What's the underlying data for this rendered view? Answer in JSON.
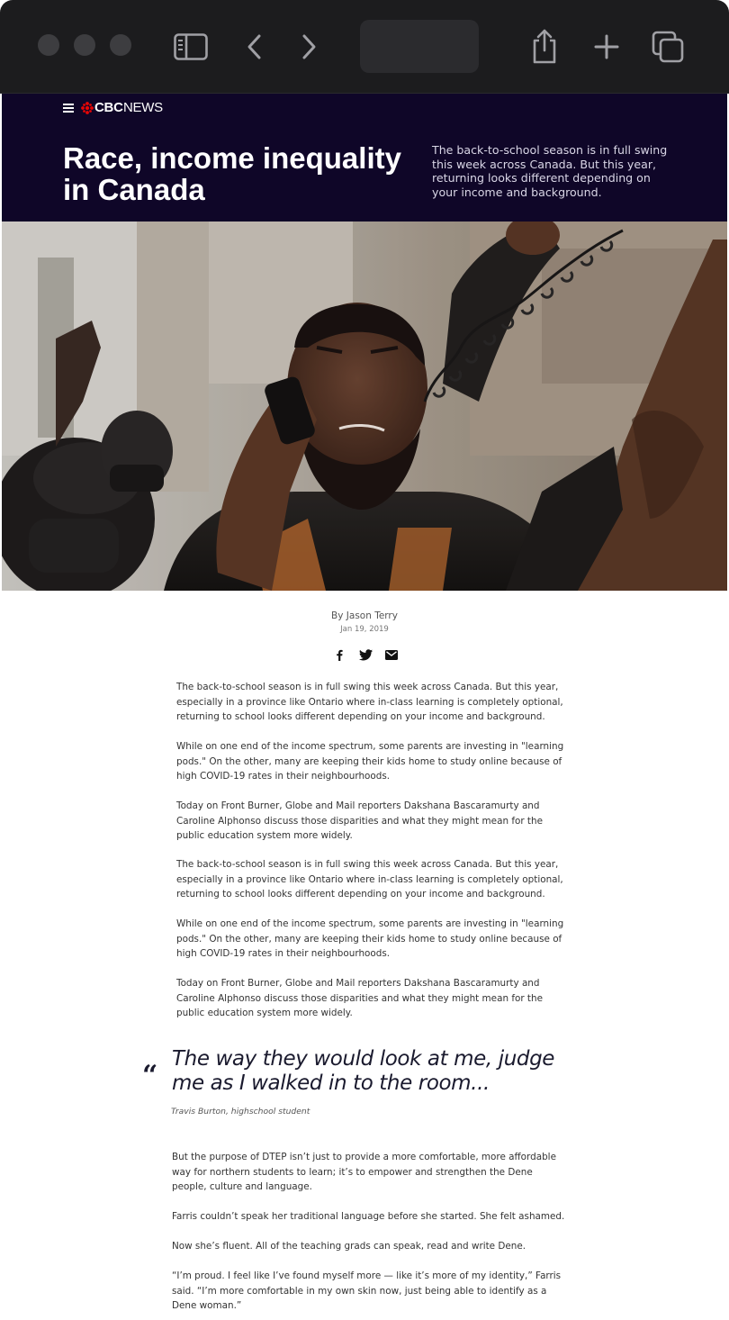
{
  "browser": {
    "icons": [
      "sidebar-icon",
      "back-icon",
      "forward-icon",
      "share-icon",
      "new-tab-icon",
      "tabs-icon"
    ]
  },
  "site": {
    "logo_cbc": "CBC",
    "logo_news": "NEWS"
  },
  "hero": {
    "title": "Race, income inequality in Canada",
    "dek": "The back-to-school season is in full swing this week across Canada. But this year, returning  looks different depending on your income and background."
  },
  "article": {
    "byline": "By Jason Terry",
    "date": "Jan 19, 2019",
    "share_icons": [
      "facebook-icon",
      "twitter-icon",
      "email-icon"
    ],
    "paragraphs": [
      "The back-to-school season is in full swing this week across Canada. But this year, especially in a province like Ontario where in-class learning is completely optional, returning to school looks different depending on your income and background.",
      "While on one end of the income spectrum, some parents are investing in \"learning pods.\" On the other, many are keeping their kids home to study online because of high COVID-19 rates in their neighbourhoods.",
      "Today on Front Burner, Globe and Mail reporters Dakshana Bascaramurty and Caroline Alphonso discuss those disparities and what they might mean for the public education system more widely.",
      "The back-to-school season is in full swing this week across Canada. But this year, especially in a province like Ontario where in-class learning is completely optional, returning to school looks different depending on your income and background.",
      "While on one end of the income spectrum, some parents are investing in \"learning pods.\" On the other, many are keeping their kids home to study online because of high COVID-19 rates in their neighbourhoods.",
      "Today on Front Burner, Globe and Mail reporters Dakshana Bascaramurty and Caroline Alphonso discuss those disparities and what they might mean for the public education system more widely."
    ],
    "quote": {
      "mark": "“",
      "text": "The way they would look at me, judge me as I walked in to the room...",
      "attribution": "Travis Burton, highschool student"
    },
    "after_paragraphs": [
      "But the purpose of DTEP isn’t just to provide a more comfortable, more affordable way for northern students to learn; it’s to empower and strengthen the Dene people, culture and language.",
      "Farris couldn’t speak her traditional language before she started. She felt ashamed.",
      "Now she’s fluent. All of the teaching grads can speak, read and write Dene.",
      "“I’m proud. I feel like I’ve found myself more — like it’s more of my identity,” Farris said. “I’m more comfortable in my own skin now, just being able to identify as a Dene woman.”"
    ]
  },
  "colors": {
    "chrome_bg": "#1c1c1e",
    "hero_bg": "#0f0628",
    "cbc_red": "#e60505",
    "body_text": "#333333"
  }
}
